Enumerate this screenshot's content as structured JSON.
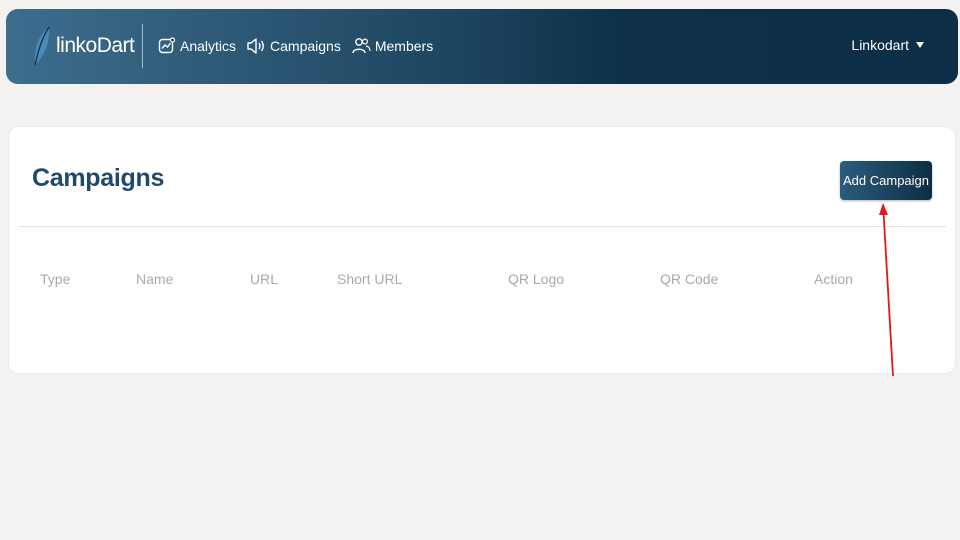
{
  "brand": {
    "name": "linkoDart"
  },
  "nav": {
    "items": [
      {
        "label": "Analytics",
        "icon": "analytics-icon"
      },
      {
        "label": "Campaigns",
        "icon": "megaphone-icon"
      },
      {
        "label": "Members",
        "icon": "members-icon"
      }
    ]
  },
  "user": {
    "name": "Linkodart"
  },
  "page": {
    "title": "Campaigns",
    "add_button_label": "Add Campaign"
  },
  "table": {
    "columns": [
      "Type",
      "Name",
      "URL",
      "Short URL",
      "QR Logo",
      "QR Code",
      "Action"
    ]
  },
  "colors": {
    "nav_gradient_start": "#3e6d8d",
    "nav_gradient_end": "#0b2d45",
    "title": "#1f4a6b",
    "annotation_arrow": "#e8161b"
  }
}
